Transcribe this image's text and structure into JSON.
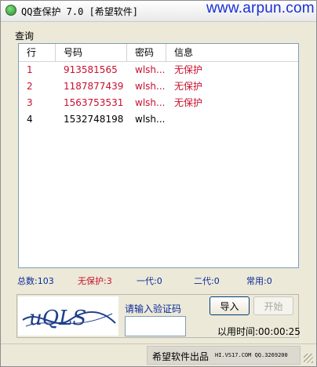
{
  "window": {
    "title": "QQ查保护 7.0  [希望软件]",
    "watermark": "www.arpun.com"
  },
  "query_group": {
    "label": "查询"
  },
  "table": {
    "columns": [
      "行",
      "号码",
      "密码",
      "信息"
    ],
    "rows": [
      {
        "row": "1",
        "number": "913581565",
        "password": "wlsh...",
        "info": "无保护",
        "color": "#c8102e"
      },
      {
        "row": "2",
        "number": "1187877439",
        "password": "wlsh...",
        "info": "无保护",
        "color": "#c8102e"
      },
      {
        "row": "3",
        "number": "1563753531",
        "password": "wlsh...",
        "info": "无保护",
        "color": "#c8102e"
      },
      {
        "row": "4",
        "number": "1532748198",
        "password": "wlsh...",
        "info": "",
        "color": "#000000"
      }
    ]
  },
  "stats": {
    "total": "总数:103",
    "unprotected": "无保护:3",
    "first_gen": "一代:0",
    "second_gen": "二代:0",
    "common": "常用:0"
  },
  "captcha": {
    "image_text": "uQLS",
    "label": "请输入验证码",
    "input_value": ""
  },
  "buttons": {
    "import": "导入",
    "start": "开始"
  },
  "elapsed": "以用时间:00:00:25",
  "footer": {
    "brand": "希望软件出品",
    "contact": "HI.VS17.COM QQ.3269200"
  },
  "colors": {
    "unprotected_red": "#c8102e",
    "stat_blue": "#0a2a9a",
    "watermark_blue": "#1a2fd6"
  }
}
